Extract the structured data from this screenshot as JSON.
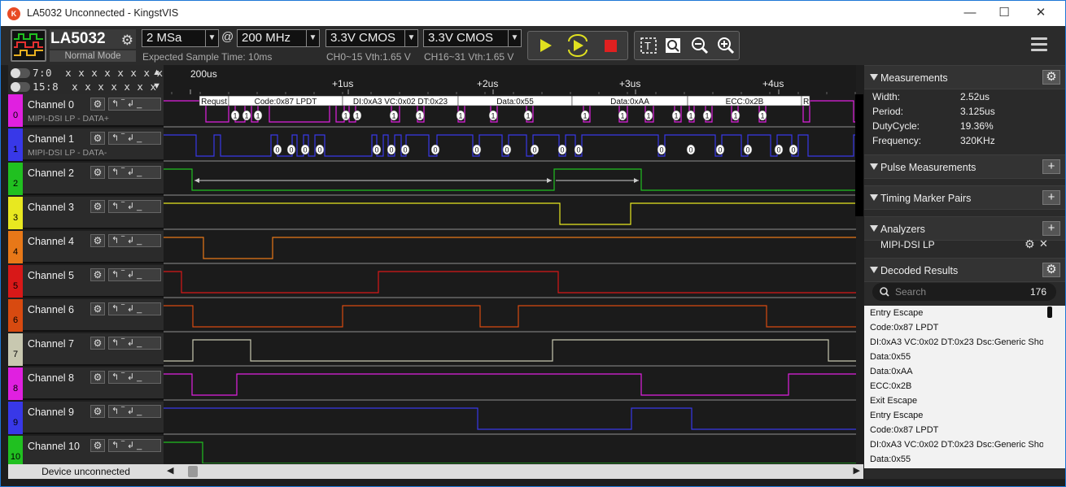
{
  "window": {
    "title": "LA5032 Unconnected - KingstVIS"
  },
  "toolbar": {
    "device_name": "LA5032",
    "device_mode": "Normal Mode",
    "sample_depth": "2 MSa",
    "at": "@",
    "sample_rate": "200 MHz",
    "expected_time": "Expected Sample Time: 10ms",
    "vth1_value": "3.3V CMOS",
    "vth1_hint": "CH0~15 Vth:1.65 V",
    "vth2_value": "3.3V CMOS",
    "vth2_hint": "CH16~31 Vth:1.65 V"
  },
  "timeline": {
    "ticks": [
      "200us",
      "+1us",
      "+2us",
      "+3us",
      "+4us"
    ]
  },
  "top_controls": {
    "row1_label": "7:0",
    "row1_bits": "x x x x x x x x",
    "row2_label": "15:8",
    "row2_bits": "x x x x x x x x"
  },
  "channels": [
    {
      "num": "0",
      "name": "Channel 0",
      "sub": "MIPI-DSI LP - DATA+",
      "color": "#e020e0"
    },
    {
      "num": "1",
      "name": "Channel 1",
      "sub": "MIPI-DSI LP - DATA-",
      "color": "#3838e8"
    },
    {
      "num": "2",
      "name": "Channel 2",
      "sub": "",
      "color": "#20c020"
    },
    {
      "num": "3",
      "name": "Channel 3",
      "sub": "",
      "color": "#e8e820"
    },
    {
      "num": "4",
      "name": "Channel 4",
      "sub": "",
      "color": "#e87818"
    },
    {
      "num": "5",
      "name": "Channel 5",
      "sub": "",
      "color": "#d81818"
    },
    {
      "num": "6",
      "name": "Channel 6",
      "sub": "",
      "color": "#d84a10"
    },
    {
      "num": "7",
      "name": "Channel 7",
      "sub": "",
      "color": "#c8c8b0"
    },
    {
      "num": "8",
      "name": "Channel 8",
      "sub": "",
      "color": "#e020e0"
    },
    {
      "num": "9",
      "name": "Channel 9",
      "sub": "",
      "color": "#3838e8"
    },
    {
      "num": "10",
      "name": "Channel 10",
      "sub": "",
      "color": "#20c020"
    }
  ],
  "decoder_labels": [
    "Requst",
    "Code:0x87 LPDT",
    "DI:0xA3 VC:0x02 DT:0x23",
    "Data:0x55",
    "Data:0xAA",
    "ECC:0x2B",
    "R"
  ],
  "device_status": "Device unconnected",
  "panel": {
    "measurements": {
      "title": "Measurements",
      "rows": [
        {
          "label": "Width:",
          "value": "2.52us"
        },
        {
          "label": "Period:",
          "value": "3.125us"
        },
        {
          "label": "DutyCycle:",
          "value": "19.36%"
        },
        {
          "label": "Frequency:",
          "value": "320KHz"
        }
      ]
    },
    "pulse_title": "Pulse Measurements",
    "timing_title": "Timing Marker Pairs",
    "analyzers": {
      "title": "Analyzers",
      "item": "MIPI-DSI LP"
    },
    "decoded": {
      "title": "Decoded Results",
      "search_placeholder": "Search",
      "count": "176",
      "results": [
        "Entry Escape",
        "Code:0x87 LPDT",
        "DI:0xA3 VC:0x02 DT:0x23 Dsc:Generic Sho...",
        "Data:0x55",
        "Data:0xAA",
        "ECC:0x2B",
        "Exit Escape",
        "Entry Escape",
        "Code:0x87 LPDT",
        "DI:0xA3 VC:0x02 DT:0x23 Dsc:Generic Sho...",
        "Data:0x55"
      ]
    }
  }
}
